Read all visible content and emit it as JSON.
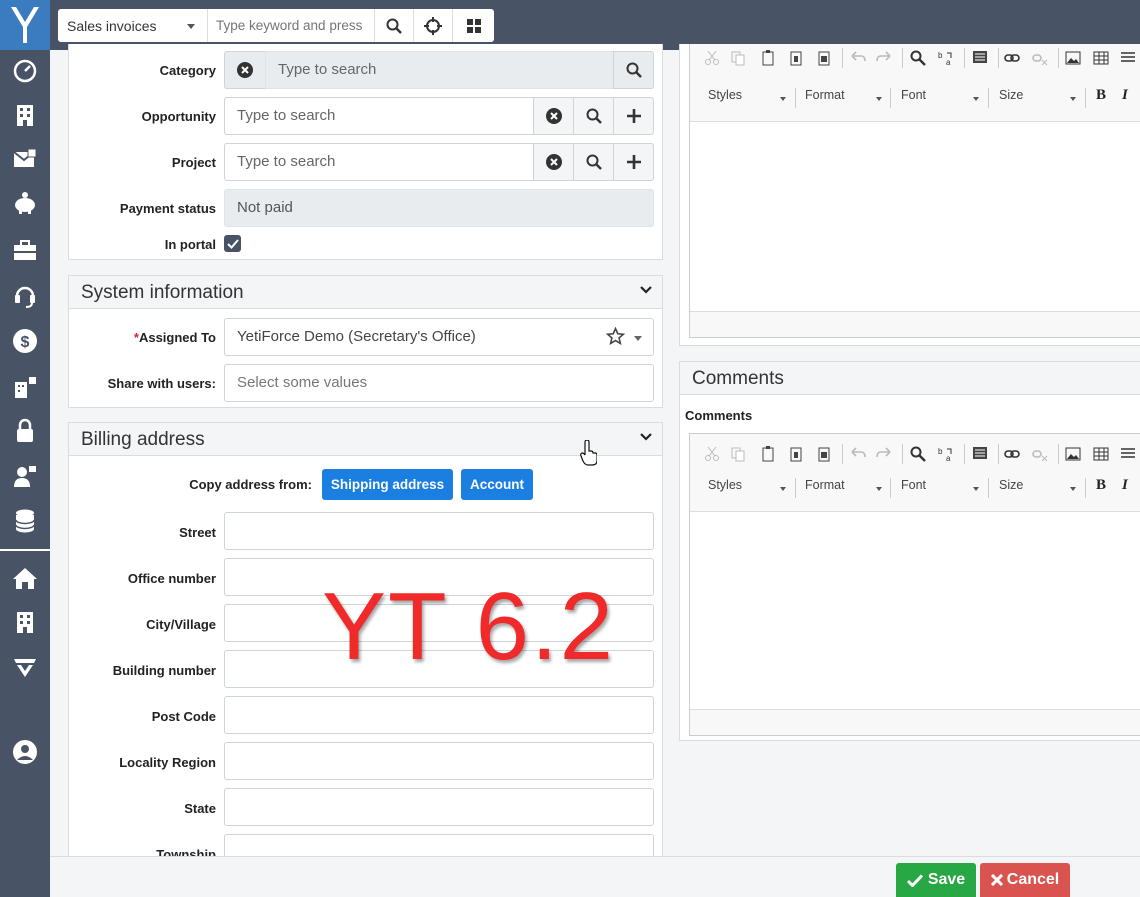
{
  "header": {
    "module_select": "Sales invoices",
    "search_placeholder": "Type keyword and press"
  },
  "details": {
    "category_label": "Category",
    "category_placeholder": "Type to search",
    "opportunity_label": "Opportunity",
    "opportunity_placeholder": "Type to search",
    "project_label": "Project",
    "project_placeholder": "Type to search",
    "payment_status_label": "Payment status",
    "payment_status_value": "Not paid",
    "in_portal_label": "In portal",
    "in_portal_checked": true
  },
  "system_information": {
    "title": "System information",
    "assigned_to_required": "*",
    "assigned_to_label": "Assigned To",
    "assigned_to_value": "YetiForce Demo (Secretary's Office)",
    "share_label": "Share with users:",
    "share_placeholder": "Select some values"
  },
  "billing_address": {
    "title": "Billing address",
    "copy_label": "Copy address from:",
    "copy_buttons": [
      "Shipping address",
      "Account"
    ],
    "fields": [
      "Street",
      "Office number",
      "City/Village",
      "Building number",
      "Post Code",
      "Locality Region",
      "State",
      "Township"
    ]
  },
  "editor": {
    "combos": [
      "Styles",
      "Format",
      "Font",
      "Size"
    ],
    "bold": "B",
    "italic": "I"
  },
  "comments": {
    "title": "Comments",
    "label": "Comments"
  },
  "footer": {
    "save_label": "Save",
    "cancel_label": "Cancel"
  },
  "watermark": "YT 6.2",
  "colors": {
    "sidebar": "#485366",
    "logo_bg": "#3b7bbf",
    "primary_button": "#1a7fe0",
    "save": "#28a745",
    "cancel": "#d9534f"
  }
}
